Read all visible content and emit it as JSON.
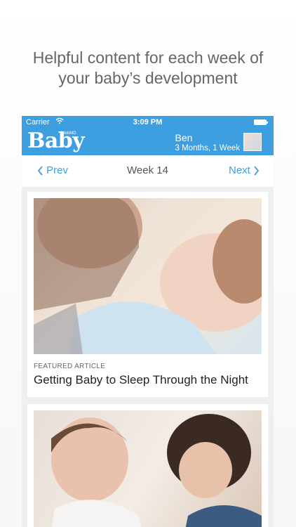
{
  "promo": {
    "line1": "Helpful content for each week of",
    "line2": "your baby’s development"
  },
  "statusbar": {
    "carrier": "Carrier",
    "time": "3:09 PM"
  },
  "appbar": {
    "logo": "Baby",
    "logo_tag": "WebMD",
    "user_name": "Ben",
    "user_age": "3 Months, 1 Week"
  },
  "week_nav": {
    "prev_label": "Prev",
    "week_label": "Week 14",
    "next_label": "Next"
  },
  "cards": [
    {
      "label": "FEATURED ARTICLE",
      "title": "Getting Baby to Sleep Through the Night"
    }
  ],
  "colors": {
    "accent": "#3d9ee0",
    "background": "#efefef"
  }
}
